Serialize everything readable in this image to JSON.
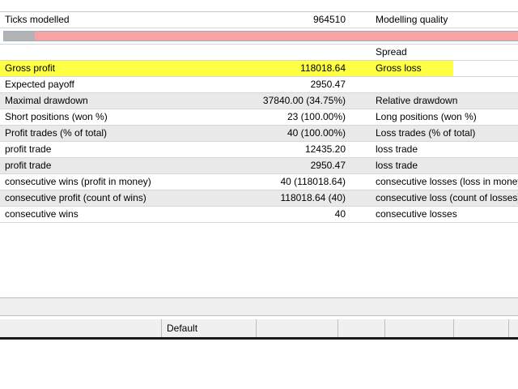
{
  "report": {
    "ticks_row": {
      "label": "Ticks modelled",
      "value": "964510",
      "right_label": "Modelling quality"
    },
    "modelling_quality_fill": 0.06,
    "spread_label": "Spread",
    "rows": [
      {
        "label": "Gross profit",
        "value": "118018.64",
        "right_label": "Gross loss",
        "highlight": true
      },
      {
        "label": "Expected payoff",
        "value": "2950.47",
        "right_label": ""
      },
      {
        "label": "Maximal drawdown",
        "value": "37840.00 (34.75%)",
        "right_label": "Relative drawdown"
      },
      {
        "label": "Short positions (won %)",
        "value": "23 (100.00%)",
        "right_label": "Long positions (won %)"
      },
      {
        "label": "Profit trades (% of total)",
        "value": "40 (100.00%)",
        "right_label": "Loss trades (% of total)"
      },
      {
        "label": "profit trade",
        "value": "12435.20",
        "right_label": "loss trade"
      },
      {
        "label": "profit trade",
        "value": "2950.47",
        "right_label": "loss trade"
      },
      {
        "label": "consecutive wins (profit in money)",
        "value": "40 (118018.64)",
        "right_label": "consecutive losses (loss in money"
      },
      {
        "label": "consecutive profit (count of wins)",
        "value": "118018.64 (40)",
        "right_label": "consecutive loss (count of losses)"
      },
      {
        "label": "consecutive wins",
        "value": "40",
        "right_label": "consecutive losses"
      }
    ]
  },
  "bottom_bar": {
    "default_label": "Default"
  },
  "colors": {
    "highlight": "#ffff33",
    "bar_track": "#f8a3a3",
    "bar_fill": "#b3b3b3"
  }
}
